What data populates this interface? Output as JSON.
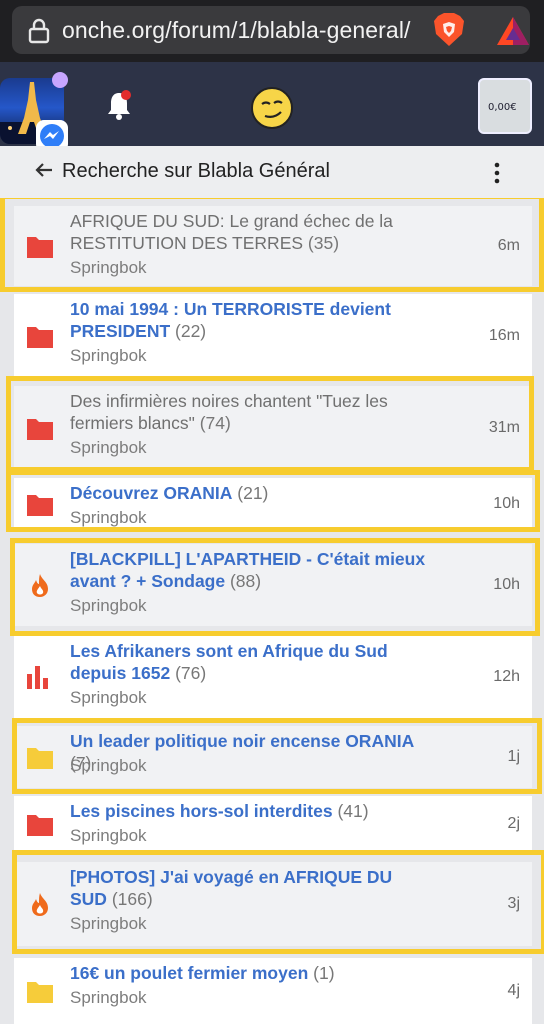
{
  "browser": {
    "url": "onche.org/forum/1/blabla-general/"
  },
  "header": {
    "ad_price": "0,00€"
  },
  "search": {
    "title": "Recherche sur Blabla Général"
  },
  "colors": {
    "accent_link": "#3b6fc9",
    "folder_hot": "#e8453c",
    "folder_normal": "#f6cc3a",
    "fire": "#ef6b1c",
    "highlight": "#f7cc2e"
  },
  "topics": [
    {
      "title": "AFRIQUE DU SUD: Le grand échec de la RESTITUTION DES TERRES",
      "count": "(35)",
      "author": "Springbok",
      "time": "6m",
      "icon": "folder-red-icon",
      "read": true
    },
    {
      "title": "10 mai 1994 : Un TERRORISTE devient PRESIDENT",
      "count": "(22)",
      "author": "Springbok",
      "time": "16m",
      "icon": "folder-red-icon",
      "read": false
    },
    {
      "title": "Des infirmières noires chantent \"Tuez les fermiers blancs\"",
      "count": "(74)",
      "author": "Springbok",
      "time": "31m",
      "icon": "folder-red-icon",
      "read": true
    },
    {
      "title": "Découvrez ORANIA",
      "count": "(21)",
      "author": "Springbok",
      "time": "10h",
      "icon": "folder-red-icon",
      "read": false
    },
    {
      "title": "[BLACKPILL] L'APARTHEID - C'était mieux avant ? + Sondage",
      "count": "(88)",
      "author": "Springbok",
      "time": "10h",
      "icon": "fire-icon",
      "read": false
    },
    {
      "title": "Les Afrikaners sont en Afrique du Sud depuis 1652",
      "count": "(76)",
      "author": "Springbok",
      "time": "12h",
      "icon": "poll-icon",
      "read": false
    },
    {
      "title": "Un leader politique noir encense ORANIA",
      "count": "(7)",
      "author": "Springbok",
      "time": "1j",
      "icon": "folder-yellow-icon",
      "read": false
    },
    {
      "title": "Les piscines hors-sol interdites",
      "count": "(41)",
      "author": "Springbok",
      "time": "2j",
      "icon": "folder-red-icon",
      "read": false
    },
    {
      "title": "[PHOTOS] J'ai voyagé en AFRIQUE DU SUD",
      "count": "(166)",
      "author": "Springbok",
      "time": "3j",
      "icon": "fire-icon",
      "read": false
    },
    {
      "title": "16€ un poulet fermier moyen",
      "count": "(1)",
      "author": "Springbok",
      "time": "4j",
      "icon": "folder-yellow-icon",
      "read": false
    }
  ]
}
